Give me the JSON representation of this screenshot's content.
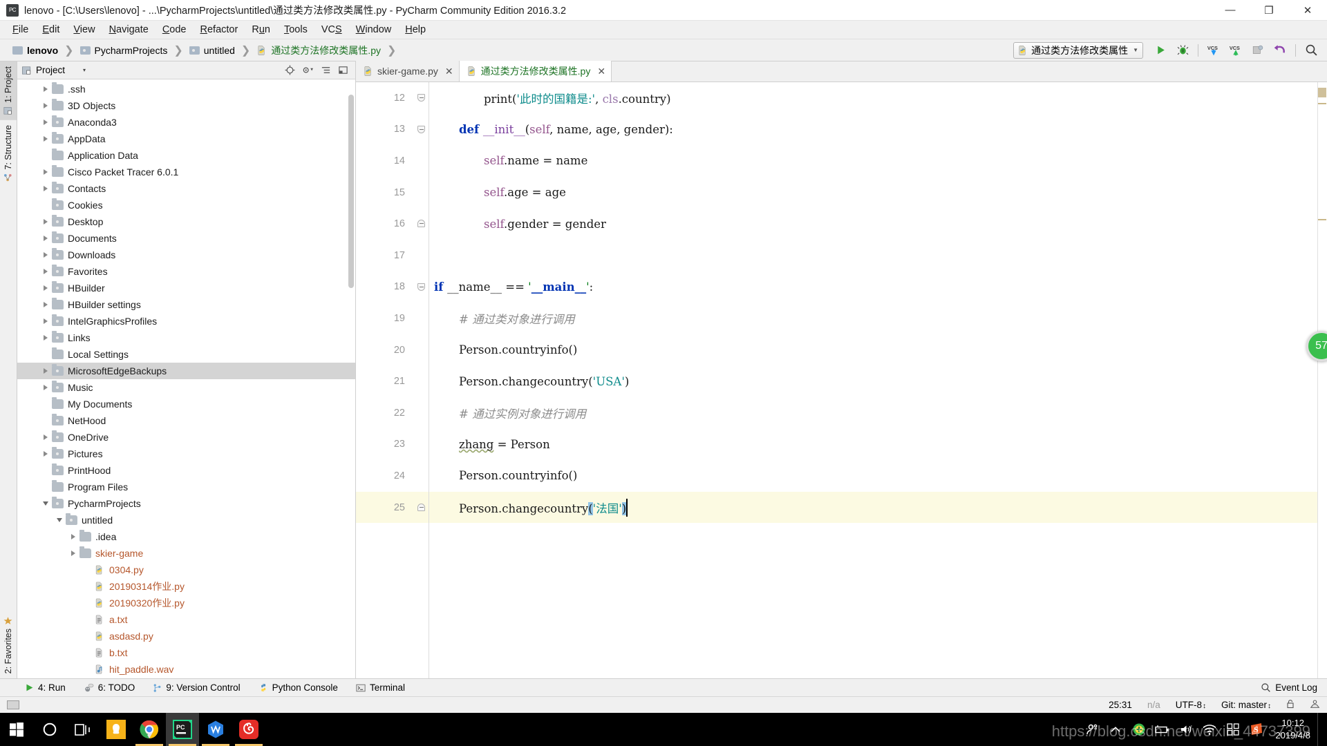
{
  "window": {
    "title": "lenovo - [C:\\Users\\lenovo] - ...\\PycharmProjects\\untitled\\通过类方法修改类属性.py - PyCharm Community Edition 2016.3.2",
    "app_icon": "pycharm-icon",
    "minimize": "—",
    "maximize": "❐",
    "close": "✕"
  },
  "menubar": {
    "items": [
      {
        "label": "File",
        "mnemonic": "F"
      },
      {
        "label": "Edit",
        "mnemonic": "E"
      },
      {
        "label": "View",
        "mnemonic": "V"
      },
      {
        "label": "Navigate",
        "mnemonic": "N"
      },
      {
        "label": "Code",
        "mnemonic": "C"
      },
      {
        "label": "Refactor",
        "mnemonic": "R"
      },
      {
        "label": "Run",
        "mnemonic": "u"
      },
      {
        "label": "Tools",
        "mnemonic": "T"
      },
      {
        "label": "VCS",
        "mnemonic": "S"
      },
      {
        "label": "Window",
        "mnemonic": "W"
      },
      {
        "label": "Help",
        "mnemonic": "H"
      }
    ]
  },
  "breadcrumb": {
    "items": [
      {
        "label": "lenovo",
        "icon": "folder-icon",
        "style": "bold"
      },
      {
        "label": "PycharmProjects",
        "icon": "folder-icon",
        "style": "normal"
      },
      {
        "label": "untitled",
        "icon": "folder-icon",
        "style": "normal"
      },
      {
        "label": "通过类方法修改类属性.py",
        "icon": "python-file-icon",
        "style": "green"
      }
    ],
    "separator": "❯"
  },
  "toolbar": {
    "run_config": "通过类方法修改类属性",
    "run_config_icon": "python-file-icon",
    "buttons": [
      {
        "name": "run-button",
        "label": "Run"
      },
      {
        "name": "debug-button",
        "label": "Debug"
      },
      {
        "name": "vcs-update-button",
        "label": "VCS"
      },
      {
        "name": "vcs-commit-button",
        "label": "VCS"
      },
      {
        "name": "vcs-changes-button",
        "label": "Changes"
      },
      {
        "name": "revert-button",
        "label": "Revert"
      },
      {
        "name": "search-everywhere-button",
        "label": "Search"
      }
    ]
  },
  "left_strip": {
    "tabs": [
      {
        "label": "1: Project",
        "mnemonic": "1",
        "icon": "project-icon",
        "active": true
      },
      {
        "label": "7: Structure",
        "mnemonic": "7",
        "icon": "structure-icon",
        "active": false
      }
    ],
    "bottom_tabs": [
      {
        "label": "2: Favorites",
        "mnemonic": "2",
        "icon": "star-icon",
        "active": false
      }
    ]
  },
  "project_panel": {
    "title": "Project",
    "caret": "▾",
    "toolbar_icons": [
      "locate-icon",
      "settings-icon",
      "collapse-icon",
      "hide-icon"
    ],
    "tree": [
      {
        "label": ".ssh",
        "indent": 1,
        "twisty": "right",
        "icon": "folder",
        "kind": "dir"
      },
      {
        "label": "3D Objects",
        "indent": 1,
        "twisty": "right",
        "icon": "folder",
        "kind": "dir"
      },
      {
        "label": "Anaconda3",
        "indent": 1,
        "twisty": "right",
        "icon": "folder-dot",
        "kind": "dir"
      },
      {
        "label": "AppData",
        "indent": 1,
        "twisty": "right",
        "icon": "folder-dot",
        "kind": "dir"
      },
      {
        "label": "Application Data",
        "indent": 1,
        "twisty": "none",
        "icon": "folder",
        "kind": "dir"
      },
      {
        "label": "Cisco Packet Tracer 6.0.1",
        "indent": 1,
        "twisty": "right",
        "icon": "folder",
        "kind": "dir"
      },
      {
        "label": "Contacts",
        "indent": 1,
        "twisty": "right",
        "icon": "folder-dot",
        "kind": "dir"
      },
      {
        "label": "Cookies",
        "indent": 1,
        "twisty": "none",
        "icon": "folder-dot",
        "kind": "dir"
      },
      {
        "label": "Desktop",
        "indent": 1,
        "twisty": "right",
        "icon": "folder-dot",
        "kind": "dir"
      },
      {
        "label": "Documents",
        "indent": 1,
        "twisty": "right",
        "icon": "folder-dot",
        "kind": "dir"
      },
      {
        "label": "Downloads",
        "indent": 1,
        "twisty": "right",
        "icon": "folder-dot",
        "kind": "dir"
      },
      {
        "label": "Favorites",
        "indent": 1,
        "twisty": "right",
        "icon": "folder-dot",
        "kind": "dir"
      },
      {
        "label": "HBuilder",
        "indent": 1,
        "twisty": "right",
        "icon": "folder-dot",
        "kind": "dir"
      },
      {
        "label": "HBuilder settings",
        "indent": 1,
        "twisty": "right",
        "icon": "folder",
        "kind": "dir"
      },
      {
        "label": "IntelGraphicsProfiles",
        "indent": 1,
        "twisty": "right",
        "icon": "folder-dot",
        "kind": "dir"
      },
      {
        "label": "Links",
        "indent": 1,
        "twisty": "right",
        "icon": "folder-dot",
        "kind": "dir"
      },
      {
        "label": "Local Settings",
        "indent": 1,
        "twisty": "none",
        "icon": "folder",
        "kind": "dir"
      },
      {
        "label": "MicrosoftEdgeBackups",
        "indent": 1,
        "twisty": "right",
        "icon": "folder-dot",
        "kind": "dir",
        "selected": true
      },
      {
        "label": "Music",
        "indent": 1,
        "twisty": "right",
        "icon": "folder-dot",
        "kind": "dir"
      },
      {
        "label": "My Documents",
        "indent": 1,
        "twisty": "none",
        "icon": "folder",
        "kind": "dir"
      },
      {
        "label": "NetHood",
        "indent": 1,
        "twisty": "none",
        "icon": "folder-dot",
        "kind": "dir"
      },
      {
        "label": "OneDrive",
        "indent": 1,
        "twisty": "right",
        "icon": "folder-dot",
        "kind": "dir"
      },
      {
        "label": "Pictures",
        "indent": 1,
        "twisty": "right",
        "icon": "folder-dot",
        "kind": "dir"
      },
      {
        "label": "PrintHood",
        "indent": 1,
        "twisty": "none",
        "icon": "folder-dot",
        "kind": "dir"
      },
      {
        "label": "Program Files",
        "indent": 1,
        "twisty": "none",
        "icon": "folder",
        "kind": "dir"
      },
      {
        "label": "PycharmProjects",
        "indent": 1,
        "twisty": "down",
        "icon": "folder-dot",
        "kind": "dir"
      },
      {
        "label": "untitled",
        "indent": 2,
        "twisty": "down",
        "icon": "folder-dot",
        "kind": "dir"
      },
      {
        "label": ".idea",
        "indent": 3,
        "twisty": "right",
        "icon": "folder",
        "kind": "dir"
      },
      {
        "label": "skier-game",
        "indent": 3,
        "twisty": "right",
        "icon": "folder",
        "kind": "dir",
        "color": "orange"
      },
      {
        "label": "0304.py",
        "indent": 4,
        "twisty": "none",
        "icon": "python",
        "kind": "file",
        "color": "orange"
      },
      {
        "label": "20190314作业.py",
        "indent": 4,
        "twisty": "none",
        "icon": "python",
        "kind": "file",
        "color": "orange"
      },
      {
        "label": "20190320作业.py",
        "indent": 4,
        "twisty": "none",
        "icon": "python",
        "kind": "file",
        "color": "orange"
      },
      {
        "label": "a.txt",
        "indent": 4,
        "twisty": "none",
        "icon": "text",
        "kind": "file",
        "color": "orange"
      },
      {
        "label": "asdasd.py",
        "indent": 4,
        "twisty": "none",
        "icon": "python",
        "kind": "file",
        "color": "orange"
      },
      {
        "label": "b.txt",
        "indent": 4,
        "twisty": "none",
        "icon": "text",
        "kind": "file",
        "color": "orange"
      },
      {
        "label": "hit_paddle.wav",
        "indent": 4,
        "twisty": "none",
        "icon": "audio",
        "kind": "file",
        "color": "orange"
      }
    ]
  },
  "editor": {
    "tabs": [
      {
        "label": "skier-game.py",
        "icon": "python-file-icon",
        "active": false,
        "color": "gray"
      },
      {
        "label": "通过类方法修改类属性.py",
        "icon": "python-file-icon",
        "active": true,
        "color": "green"
      }
    ],
    "close_glyph": "✕",
    "lines": [
      {
        "num": "12",
        "indent": 2,
        "fold": "minus-bottom",
        "tokens": [
          {
            "t": "print",
            "c": "plain"
          },
          {
            "t": "(",
            "c": "plain"
          },
          {
            "t": "'此时的国籍是:'",
            "c": "strcn"
          },
          {
            "t": ", ",
            "c": "plain"
          },
          {
            "t": "cls",
            "c": "clsref"
          },
          {
            "t": ".country)",
            "c": "plain"
          }
        ]
      },
      {
        "num": "13",
        "indent": 1,
        "fold": "plus",
        "tokens": [
          {
            "t": "def ",
            "c": "kw"
          },
          {
            "t": "__init__",
            "c": "fn"
          },
          {
            "t": "(",
            "c": "plain"
          },
          {
            "t": "self",
            "c": "selfc"
          },
          {
            "t": ", name, age, gender):",
            "c": "plain"
          }
        ]
      },
      {
        "num": "14",
        "indent": 2,
        "fold": "none",
        "tokens": [
          {
            "t": "self",
            "c": "selfc"
          },
          {
            "t": ".name = name",
            "c": "plain"
          }
        ]
      },
      {
        "num": "15",
        "indent": 2,
        "fold": "none",
        "tokens": [
          {
            "t": "self",
            "c": "selfc"
          },
          {
            "t": ".age = age",
            "c": "plain"
          }
        ]
      },
      {
        "num": "16",
        "indent": 2,
        "fold": "minus-top",
        "tokens": [
          {
            "t": "self",
            "c": "selfc"
          },
          {
            "t": ".gender = gender",
            "c": "plain"
          }
        ]
      },
      {
        "num": "17",
        "indent": 0,
        "fold": "none",
        "tokens": []
      },
      {
        "num": "18",
        "indent": 0,
        "fold": "plus",
        "tokens": [
          {
            "t": "if ",
            "c": "kw"
          },
          {
            "t": "__name__",
            "c": "plain"
          },
          {
            "t": " == ",
            "c": "plain"
          },
          {
            "t": "'",
            "c": "str"
          },
          {
            "t": "__main__",
            "c": "dunder"
          },
          {
            "t": "'",
            "c": "str"
          },
          {
            "t": ":",
            "c": "plain"
          }
        ]
      },
      {
        "num": "19",
        "indent": 1,
        "fold": "none",
        "tokens": [
          {
            "t": "# 通过类对象进行调用",
            "c": "cmt"
          }
        ]
      },
      {
        "num": "20",
        "indent": 1,
        "fold": "none",
        "tokens": [
          {
            "t": "Person.countryinfo()",
            "c": "plain"
          }
        ]
      },
      {
        "num": "21",
        "indent": 1,
        "fold": "none",
        "tokens": [
          {
            "t": "Person.changecountry(",
            "c": "plain"
          },
          {
            "t": "'USA'",
            "c": "strcn"
          },
          {
            "t": ")",
            "c": "plain"
          }
        ]
      },
      {
        "num": "22",
        "indent": 1,
        "fold": "none",
        "tokens": [
          {
            "t": "# 通过实例对象进行调用",
            "c": "cmt"
          }
        ]
      },
      {
        "num": "23",
        "indent": 1,
        "fold": "none",
        "tokens": [
          {
            "t": "zhang",
            "c": "squiggle"
          },
          {
            "t": " = Person",
            "c": "plain"
          }
        ]
      },
      {
        "num": "24",
        "indent": 1,
        "fold": "none",
        "tokens": [
          {
            "t": "Person.countryinfo()",
            "c": "plain"
          }
        ]
      },
      {
        "num": "25",
        "indent": 1,
        "fold": "minus-top",
        "current": true,
        "tokens": [
          {
            "t": "Person.changecountry",
            "c": "plain"
          },
          {
            "t": "(",
            "c": "paren"
          },
          {
            "t": "'法国'",
            "c": "strcn"
          },
          {
            "t": ")",
            "c": "paren"
          }
        ]
      }
    ],
    "inspection_badge": "57"
  },
  "tool_window_bar": {
    "buttons": [
      {
        "label": "4: Run",
        "mnemonic": "4",
        "icon": "run-icon"
      },
      {
        "label": "6: TODO",
        "mnemonic": "6",
        "icon": "todo-icon"
      },
      {
        "label": "9: Version Control",
        "mnemonic": "9",
        "icon": "vcs-icon"
      },
      {
        "label": "Python Console",
        "mnemonic": "",
        "icon": "python-console-icon"
      },
      {
        "label": "Terminal",
        "mnemonic": "",
        "icon": "terminal-icon"
      }
    ],
    "event_log": "Event Log",
    "event_log_icon": "search-icon"
  },
  "status_bar": {
    "caret_position": "25:31",
    "line_separator": "n/a",
    "encoding": "UTF-8",
    "branch": "Git: master",
    "lock_icon": "lock-icon",
    "inspection_icon": "inspector-icon"
  },
  "taskbar": {
    "items": [
      {
        "name": "start-button",
        "icon": "windows-icon",
        "active": false,
        "running": false
      },
      {
        "name": "cortana-button",
        "icon": "cortana-icon",
        "active": false,
        "running": false
      },
      {
        "name": "task-view-button",
        "icon": "task-view-icon",
        "active": false,
        "running": false
      },
      {
        "name": "sogou-input-button",
        "icon": "sogou-icon",
        "active": false,
        "running": false
      },
      {
        "name": "chrome-button",
        "icon": "chrome-icon",
        "active": false,
        "running": true
      },
      {
        "name": "pycharm-button",
        "icon": "pycharm-icon",
        "active": true,
        "running": true
      },
      {
        "name": "wps-button",
        "icon": "wps-icon",
        "active": false,
        "running": true
      },
      {
        "name": "netease-music-button",
        "icon": "netease-icon",
        "active": false,
        "running": true
      }
    ],
    "tray": [
      {
        "name": "people-icon",
        "glyph": "὆4"
      },
      {
        "name": "show-hidden-icon",
        "glyph": "∧"
      },
      {
        "name": "security-icon",
        "glyph": "+"
      },
      {
        "name": "battery-icon",
        "glyph": "battery"
      },
      {
        "name": "volume-icon",
        "glyph": "volume"
      },
      {
        "name": "network-icon",
        "glyph": "wifi"
      },
      {
        "name": "action-center-icon",
        "glyph": "squares"
      },
      {
        "name": "sogou-tray-icon",
        "glyph": "S"
      }
    ],
    "clock_time": "10:12",
    "clock_date": "2019/4/8"
  },
  "watermark": "https://blog.csdn.net/weixin_44737399"
}
